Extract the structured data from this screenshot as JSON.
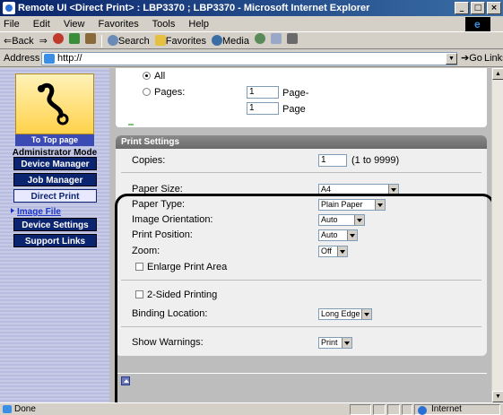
{
  "window": {
    "title": "Remote UI <Direct Print> : LBP3370 ; LBP3370 - Microsoft Internet Explorer",
    "buttons": {
      "minimize": "_",
      "maximize": "□",
      "close": "×"
    }
  },
  "menu": [
    "File",
    "Edit",
    "View",
    "Favorites",
    "Tools",
    "Help"
  ],
  "toolbar": {
    "back": "⇐Back",
    "forward": "⇒",
    "search": "Search",
    "favorites": "Favorites",
    "media": "Media"
  },
  "address": {
    "label": "Address",
    "url": "http://",
    "go": "Go",
    "links": "Links"
  },
  "sidebar": {
    "top_page": "To Top page",
    "mode": "Administrator Mode",
    "nav": [
      "Device Manager",
      "Job Manager",
      "Direct Print",
      "Device Settings",
      "Support Links"
    ],
    "sub_link": "Image File"
  },
  "pages_section": {
    "all_label": "All",
    "pages_label": "Pages:",
    "from_value": "1",
    "to_value": "1",
    "page_from_suffix": "Page-",
    "page_to_suffix": "Page"
  },
  "print_settings": {
    "header": "Print Settings",
    "copies_label": "Copies:",
    "copies_value": "1",
    "copies_range": "(1 to 9999)",
    "paper_size_label": "Paper Size:",
    "paper_size_value": "A4",
    "paper_type_label": "Paper Type:",
    "paper_type_value": "Plain Paper",
    "orientation_label": "Image Orientation:",
    "orientation_value": "Auto",
    "position_label": "Print Position:",
    "position_value": "Auto",
    "zoom_label": "Zoom:",
    "zoom_value": "Off",
    "enlarge_label": "Enlarge Print Area",
    "two_sided_label": "2-Sided Printing",
    "binding_label": "Binding Location:",
    "binding_value": "Long Edge",
    "warnings_label": "Show Warnings:",
    "warnings_value": "Print"
  },
  "status": {
    "text": "Done",
    "zone": "Internet"
  }
}
